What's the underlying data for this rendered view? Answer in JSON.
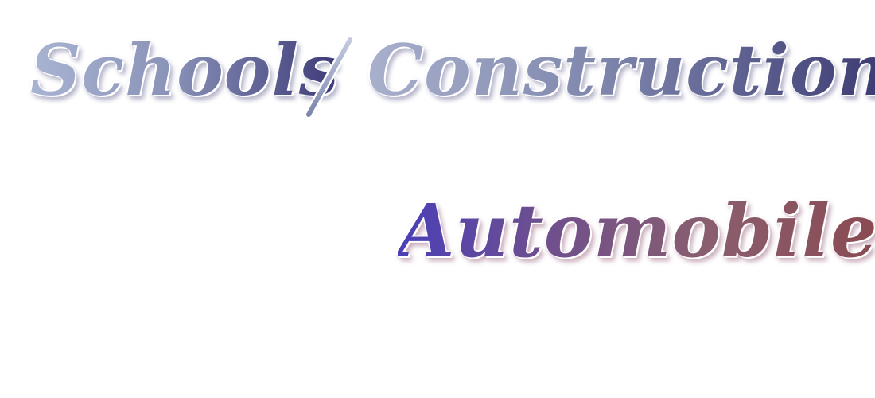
{
  "headline": {
    "schools": "Schools",
    "construction": "Construction"
  },
  "subheading": {
    "automobile": "Automobile"
  },
  "colors": {
    "gray_blue_light": "#a9b4d2",
    "indigo_dark": "#3d3a78",
    "violet": "#4a3fb8",
    "maroon": "#8a4a52"
  }
}
